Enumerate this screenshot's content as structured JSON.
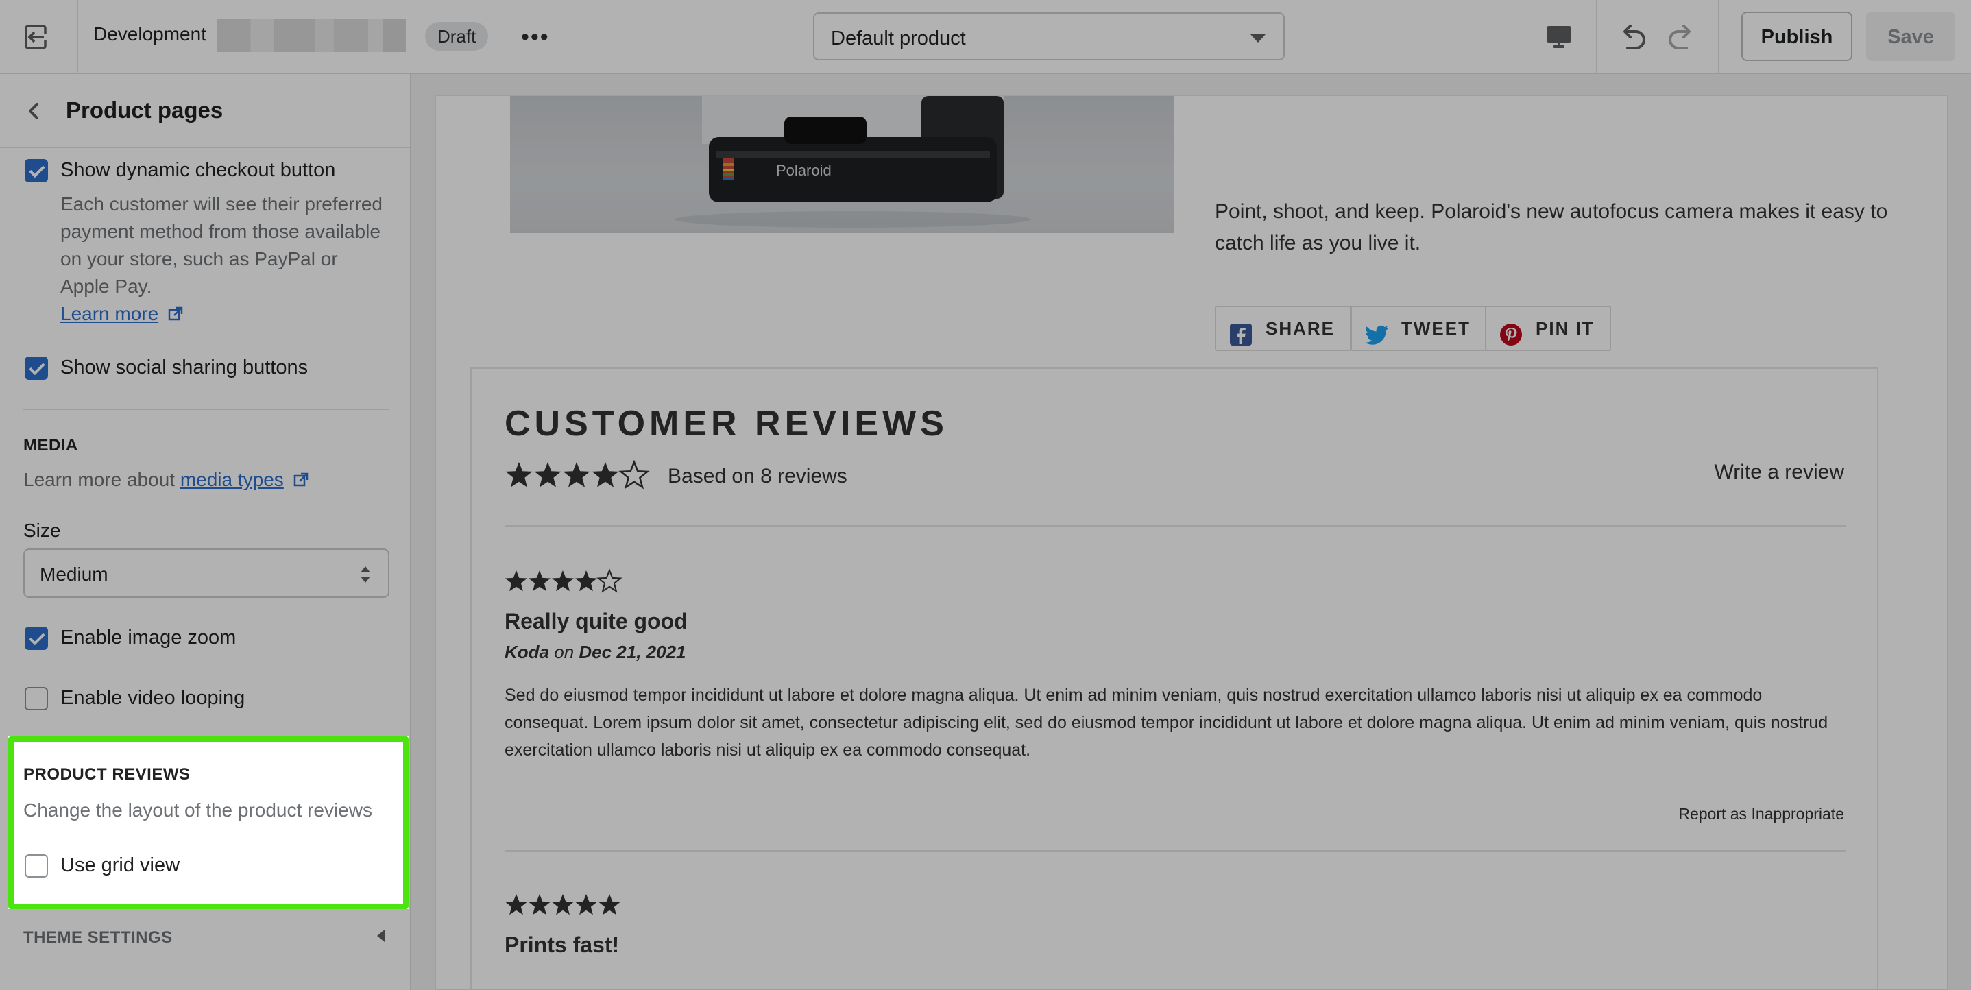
{
  "topbar": {
    "exit_icon": "exit-icon",
    "environment": "Development",
    "status_badge": "Draft",
    "more_icon": "more-horizontal-icon",
    "product_selector": "Default product",
    "preview_icon": "desktop-icon",
    "undo_icon": "undo-icon",
    "redo_icon": "redo-icon",
    "publish_label": "Publish",
    "save_label": "Save"
  },
  "sidebar": {
    "title": "Product pages",
    "dynamic_checkout": {
      "label": "Show dynamic checkout button",
      "checked": true,
      "help": "Each customer will see their preferred payment method from those available on your store, such as PayPal or Apple Pay.",
      "learn_more": "Learn more"
    },
    "social_sharing": {
      "label": "Show social sharing buttons",
      "checked": true
    },
    "media": {
      "heading": "MEDIA",
      "learn_prefix": "Learn more about",
      "learn_link": "media types",
      "size_label": "Size",
      "size_value": "Medium",
      "image_zoom": {
        "label": "Enable image zoom",
        "checked": true
      },
      "video_looping": {
        "label": "Enable video looping",
        "checked": false
      }
    },
    "product_reviews": {
      "heading": "PRODUCT REVIEWS",
      "help": "Change the layout of the product reviews",
      "grid_view": {
        "label": "Use grid view",
        "checked": false
      }
    },
    "theme_settings": "THEME SETTINGS"
  },
  "preview": {
    "description": "Point, shoot, and keep. Polaroid's new autofocus camera makes it easy to catch life as you live it.",
    "camera_brand": "Polaroid",
    "share_buttons": [
      {
        "label": "SHARE",
        "icon": "facebook-icon",
        "color": "#3b5998"
      },
      {
        "label": "TWEET",
        "icon": "twitter-icon",
        "color": "#1da1f2"
      },
      {
        "label": "PIN IT",
        "icon": "pinterest-icon",
        "color": "#bd081c"
      }
    ],
    "reviews": {
      "title": "CUSTOMER REVIEWS",
      "average_rating": 4.5,
      "based_on": "Based on 8 reviews",
      "write_review": "Write a review",
      "items": [
        {
          "rating": 4,
          "title": "Really quite good",
          "author": "Koda",
          "on": "on",
          "date": "Dec 21, 2021",
          "body": "Sed do eiusmod tempor incididunt ut labore et dolore magna aliqua. Ut enim ad minim veniam, quis nostrud exercitation ullamco laboris nisi ut aliquip ex ea commodo consequat. Lorem ipsum dolor sit amet, consectetur adipiscing elit, sed do eiusmod tempor incididunt ut labore et dolore magna aliqua. Ut enim ad minim veniam, quis nostrud exercitation ullamco laboris nisi ut aliquip ex ea commodo consequat.",
          "report": "Report as Inappropriate"
        },
        {
          "rating": 5,
          "title": "Prints fast!"
        }
      ]
    }
  },
  "colors": {
    "accent": "#2c6ecb",
    "highlight": "#4be40f",
    "overlay": "rgba(0,0,0,0.30)"
  }
}
